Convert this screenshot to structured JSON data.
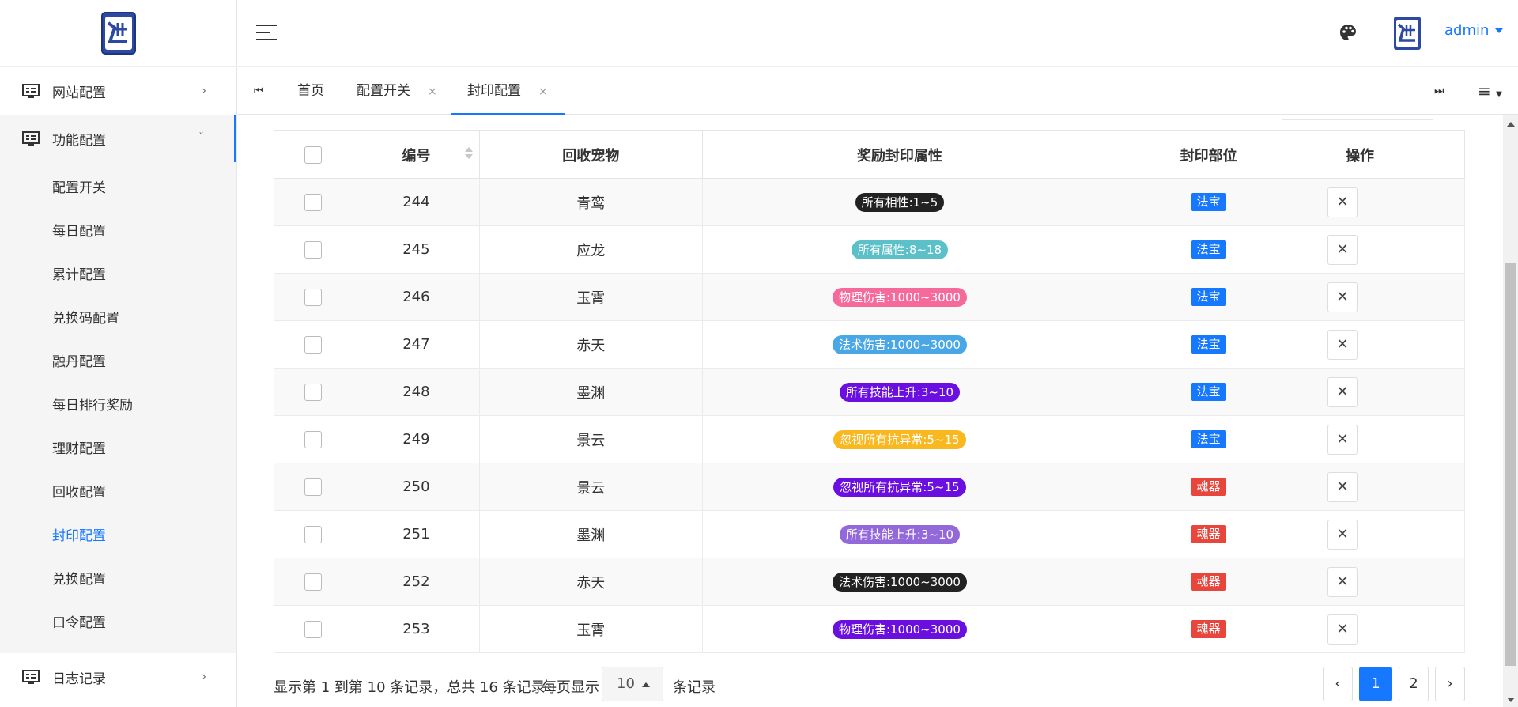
{
  "sidebar": {
    "groups": [
      {
        "label": "网站配置",
        "chevron": "›"
      },
      {
        "label": "功能配置",
        "chevron": "ˇ"
      },
      {
        "label": "日志记录",
        "chevron": "›"
      }
    ],
    "sub_items": [
      "配置开关",
      "每日配置",
      "累计配置",
      "兑换码配置",
      "融丹配置",
      "每日排行奖励",
      "理财配置",
      "回收配置",
      "封印配置",
      "兑换配置",
      "口令配置"
    ],
    "active_sub": "封印配置"
  },
  "header": {
    "user": "admin",
    "icons": [
      "menu-toggle-icon",
      "palette-icon",
      "avatar"
    ]
  },
  "tabs": {
    "first_icon": "⏮",
    "items": [
      {
        "label": "首页",
        "closable": false
      },
      {
        "label": "配置开关",
        "closable": true
      },
      {
        "label": "封印配置",
        "closable": true
      }
    ],
    "close_glyph": "×",
    "last_icon": "⏭",
    "menu_icon": "≡"
  },
  "table": {
    "columns": [
      "编号",
      "回收宠物",
      "奖励封印属性",
      "封印部位",
      "操作"
    ],
    "rows": [
      {
        "id": "244",
        "pet": "青鸾",
        "attr": "所有相性:1~5",
        "attr_color": "#222222",
        "part": "法宝",
        "part_color": "#1677ff"
      },
      {
        "id": "245",
        "pet": "应龙",
        "attr": "所有属性:8~18",
        "attr_color": "#5bc0c8",
        "part": "法宝",
        "part_color": "#1677ff"
      },
      {
        "id": "246",
        "pet": "玉霄",
        "attr": "物理伤害:1000~3000",
        "attr_color": "#f56a9a",
        "part": "法宝",
        "part_color": "#1677ff"
      },
      {
        "id": "247",
        "pet": "赤天",
        "attr": "法术伤害:1000~3000",
        "attr_color": "#4aa7e6",
        "part": "法宝",
        "part_color": "#1677ff"
      },
      {
        "id": "248",
        "pet": "墨渊",
        "attr": "所有技能上升:3~10",
        "attr_color": "#6a0fe0",
        "part": "法宝",
        "part_color": "#1677ff"
      },
      {
        "id": "249",
        "pet": "景云",
        "attr": "忽视所有抗异常:5~15",
        "attr_color": "#f9b820",
        "part": "法宝",
        "part_color": "#1677ff"
      },
      {
        "id": "250",
        "pet": "景云",
        "attr": "忽视所有抗异常:5~15",
        "attr_color": "#6a0fe0",
        "part": "魂器",
        "part_color": "#e8463c"
      },
      {
        "id": "251",
        "pet": "墨渊",
        "attr": "所有技能上升:3~10",
        "attr_color": "#9368d8",
        "part": "魂器",
        "part_color": "#e8463c"
      },
      {
        "id": "252",
        "pet": "赤天",
        "attr": "法术伤害:1000~3000",
        "attr_color": "#222222",
        "part": "魂器",
        "part_color": "#e8463c"
      },
      {
        "id": "253",
        "pet": "玉霄",
        "attr": "物理伤害:1000~3000",
        "attr_color": "#6a0fe0",
        "part": "魂器",
        "part_color": "#e8463c"
      }
    ],
    "delete_glyph": "✕"
  },
  "footer": {
    "info": "显示第 1 到第 10 条记录，总共 16 条记录",
    "page_size_prefix": "每页显示",
    "page_size": "10",
    "page_size_suffix": "条记录",
    "prev": "‹",
    "pages": [
      "1",
      "2"
    ],
    "current_page": "1",
    "next": "›"
  }
}
